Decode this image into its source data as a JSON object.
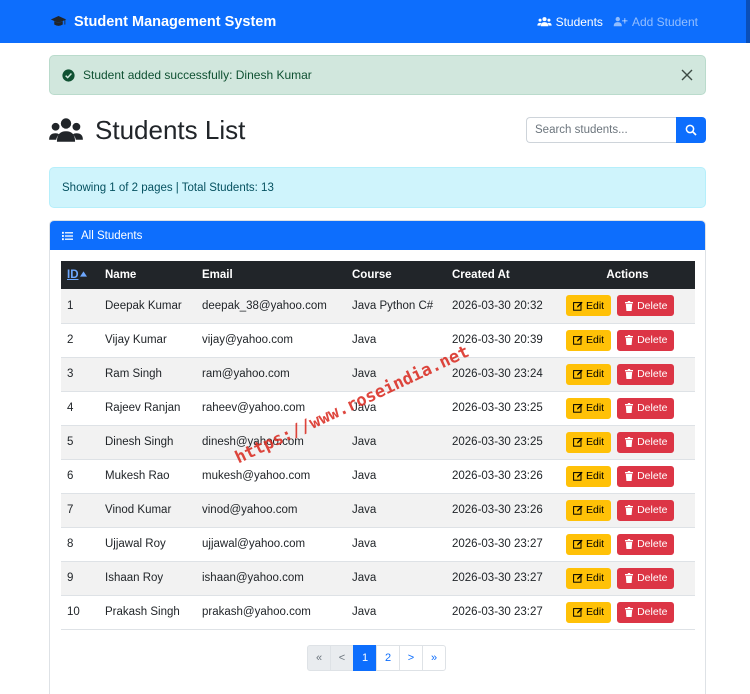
{
  "navbar": {
    "brand": "Student Management System",
    "links": [
      {
        "label": "Students",
        "active": true
      },
      {
        "label": "Add Student",
        "active": false
      }
    ]
  },
  "alert": {
    "message": "Student added successfully: Dinesh Kumar"
  },
  "page": {
    "title": "Students List"
  },
  "search": {
    "placeholder": "Search students..."
  },
  "info": {
    "text": "Showing 1 of 2 pages | Total Students: 13"
  },
  "card": {
    "header": "All Students"
  },
  "table": {
    "headers": {
      "id": "ID",
      "name": "Name",
      "email": "Email",
      "course": "Course",
      "created": "Created At",
      "actions": "Actions"
    },
    "edit_label": "Edit",
    "delete_label": "Delete",
    "rows": [
      {
        "id": "1",
        "name": "Deepak Kumar",
        "email": "deepak_38@yahoo.com",
        "course": "Java Python C#",
        "created": "2026-03-30 20:32"
      },
      {
        "id": "2",
        "name": "Vijay Kumar",
        "email": "vijay@yahoo.com",
        "course": "Java",
        "created": "2026-03-30 20:39"
      },
      {
        "id": "3",
        "name": "Ram Singh",
        "email": "ram@yahoo.com",
        "course": "Java",
        "created": "2026-03-30 23:24"
      },
      {
        "id": "4",
        "name": "Rajeev Ranjan",
        "email": "raheev@yahoo.com",
        "course": "Java",
        "created": "2026-03-30 23:25"
      },
      {
        "id": "5",
        "name": "Dinesh Singh",
        "email": "dinesh@yahoo.com",
        "course": "Java",
        "created": "2026-03-30 23:25"
      },
      {
        "id": "6",
        "name": "Mukesh Rao",
        "email": "mukesh@yahoo.com",
        "course": "Java",
        "created": "2026-03-30 23:26"
      },
      {
        "id": "7",
        "name": "Vinod Kumar",
        "email": "vinod@yahoo.com",
        "course": "Java",
        "created": "2026-03-30 23:26"
      },
      {
        "id": "8",
        "name": "Ujjawal Roy",
        "email": "ujjawal@yahoo.com",
        "course": "Java",
        "created": "2026-03-30 23:27"
      },
      {
        "id": "9",
        "name": "Ishaan Roy",
        "email": "ishaan@yahoo.com",
        "course": "Java",
        "created": "2026-03-30 23:27"
      },
      {
        "id": "10",
        "name": "Prakash Singh",
        "email": "prakash@yahoo.com",
        "course": "Java",
        "created": "2026-03-30 23:27"
      }
    ]
  },
  "pagination": {
    "first": "«",
    "prev": "<",
    "pages": [
      "1",
      "2"
    ],
    "current": "1",
    "next": ">",
    "last": "»"
  },
  "watermark": "https://www.roseindia.net"
}
